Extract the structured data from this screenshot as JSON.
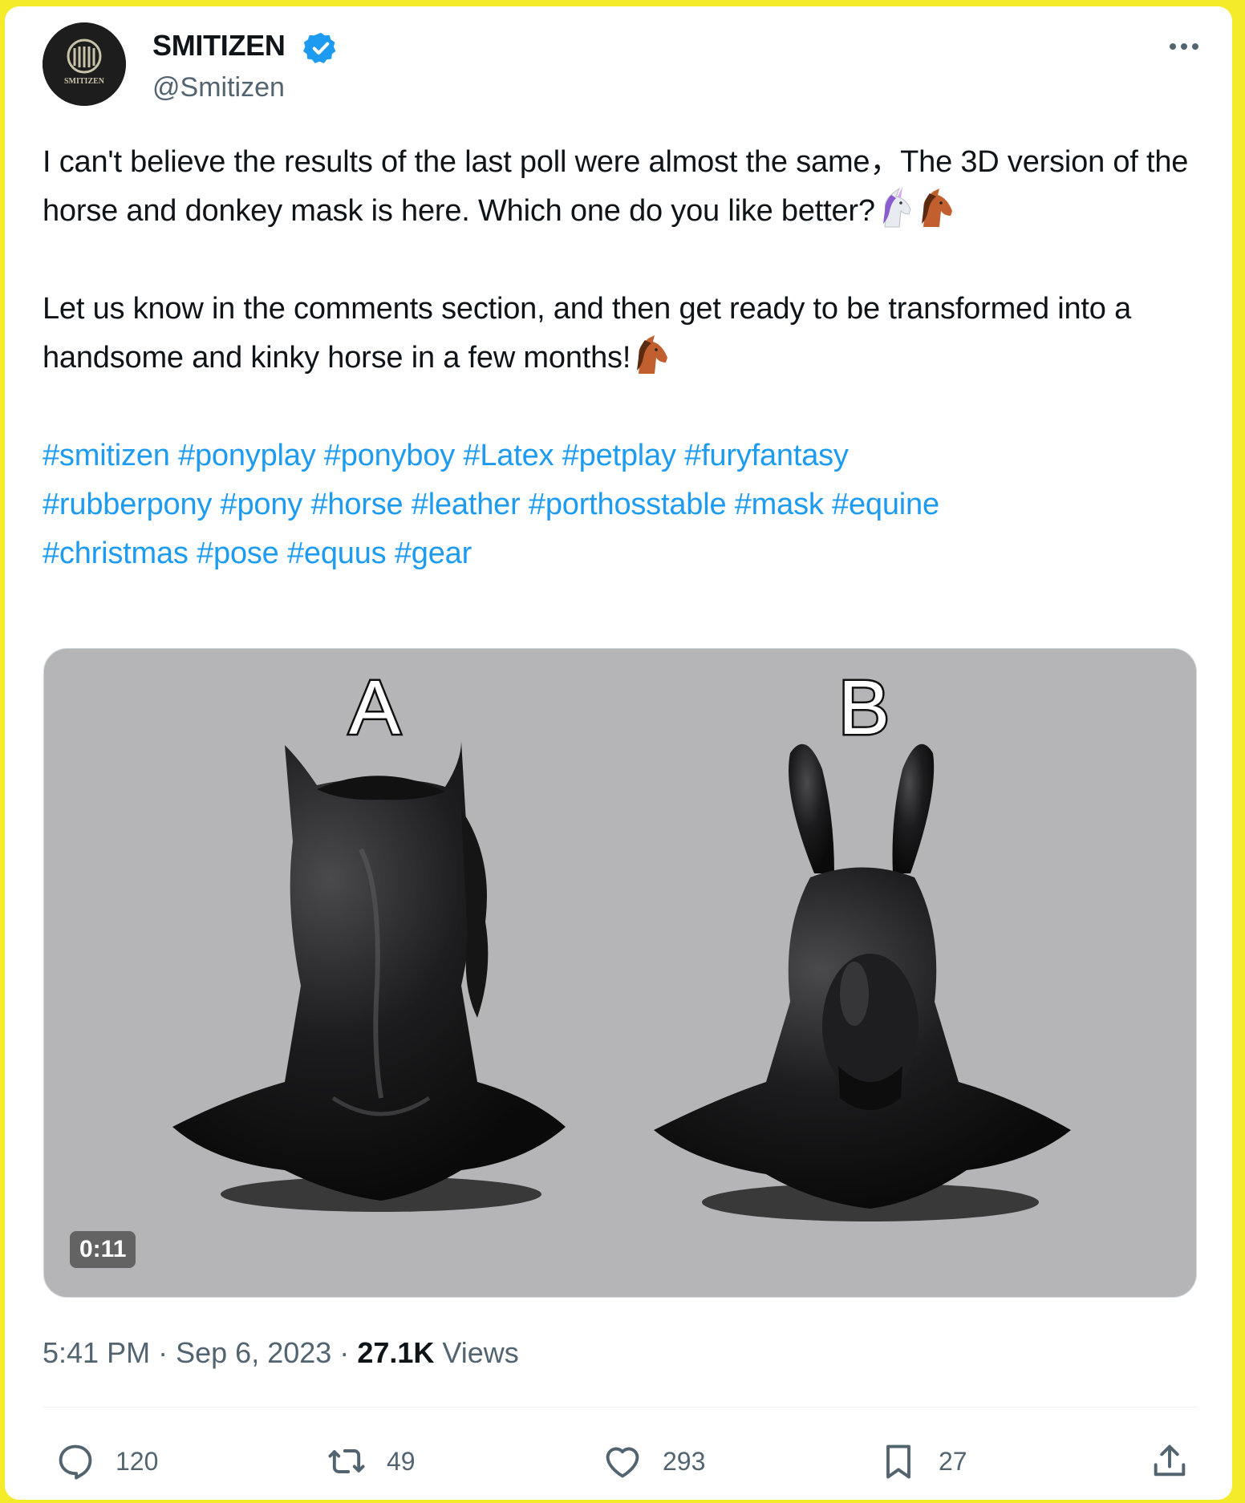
{
  "post": {
    "author": {
      "name": "SMITIZEN",
      "handle": "@Smitizen",
      "avatar_text": "SMITIZEN",
      "verified_color": "#1d9bf0"
    },
    "text": {
      "paragraph1": "I can't believe the results of the last poll were almost the same，The 3D version of the horse and donkey mask is here. Which one do you like better?",
      "paragraph2": "Let us know in the comments section, and then get ready to be transformed into a handsome and kinky horse in a few months!",
      "hashtags": [
        "#smitizen",
        "#ponyplay",
        "#ponyboy",
        "#Latex",
        "#petplay",
        "#furyfantasy",
        "#rubberpony",
        "#pony",
        "#horse",
        "#leather",
        "#porthosstable",
        "#mask",
        "#equine",
        "#christmas",
        "#pose",
        "#equus",
        "#gear"
      ],
      "emoji1": [
        "unicorn-icon",
        "horse-icon"
      ],
      "emoji2": [
        "horse-icon"
      ]
    },
    "media": {
      "label_a": "A",
      "label_b": "B",
      "duration": "0:11",
      "background": "#b5b5b7"
    },
    "meta": {
      "time": "5:41 PM",
      "date": "Sep 6, 2023",
      "views_count": "27.1K",
      "views_label": "Views"
    },
    "actions": {
      "replies": "120",
      "reposts": "49",
      "likes": "293",
      "bookmarks": "27"
    },
    "colors": {
      "link": "#1d9bf0",
      "text": "#0f1419",
      "secondary": "#536471",
      "frame": "#f4ec2a"
    }
  }
}
